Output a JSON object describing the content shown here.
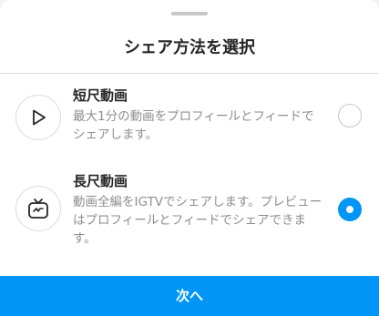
{
  "sheet": {
    "title": "シェア方法を選択"
  },
  "options": [
    {
      "title": "短尺動画",
      "description": "最大1分の動画をプロフィールとフィードでシェアします。",
      "icon": "play-icon",
      "selected": false
    },
    {
      "title": "長尺動画",
      "description": "動画全編をIGTVでシェアします。プレビューはプロフィールとフィードでシェアできます。",
      "icon": "igtv-icon",
      "selected": true
    }
  ],
  "footer": {
    "next_label": "次へ"
  },
  "colors": {
    "accent": "#0095f6",
    "text_primary": "#262626",
    "text_secondary": "#8e8e8e",
    "divider": "#dbdbdb"
  }
}
